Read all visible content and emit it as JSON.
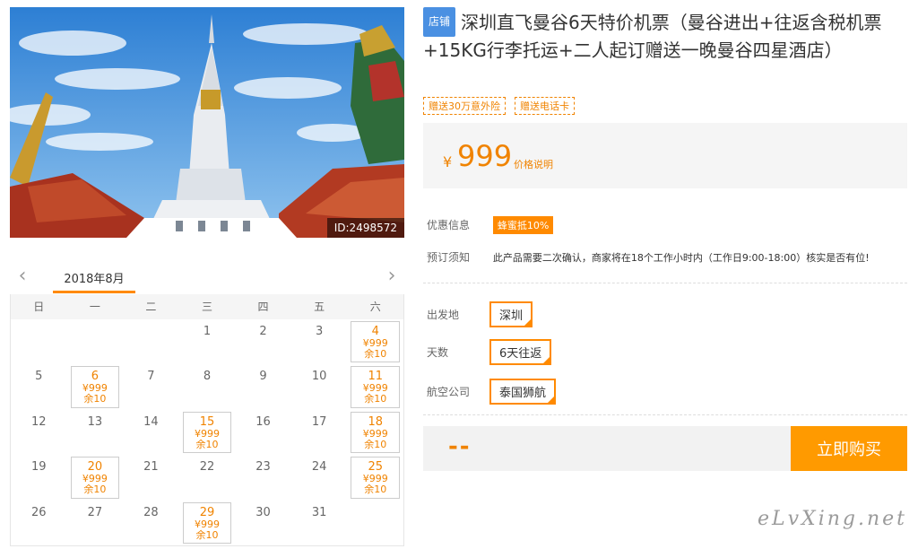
{
  "hero": {
    "id_label": "ID:2498572"
  },
  "calendar": {
    "month": "2018年8月",
    "prev_icon": "chevron-left-icon",
    "next_icon": "chevron-right-icon",
    "weekdays": [
      "日",
      "一",
      "二",
      "三",
      "四",
      "五",
      "六"
    ],
    "days": [
      {
        "d": ""
      },
      {
        "d": ""
      },
      {
        "d": ""
      },
      {
        "d": "1"
      },
      {
        "d": "2"
      },
      {
        "d": "3"
      },
      {
        "d": "4",
        "price": "¥999",
        "rest": "余10"
      },
      {
        "d": "5"
      },
      {
        "d": "6",
        "price": "¥999",
        "rest": "余10"
      },
      {
        "d": "7"
      },
      {
        "d": "8"
      },
      {
        "d": "9"
      },
      {
        "d": "10"
      },
      {
        "d": "11",
        "price": "¥999",
        "rest": "余10"
      },
      {
        "d": "12"
      },
      {
        "d": "13"
      },
      {
        "d": "14"
      },
      {
        "d": "15",
        "price": "¥999",
        "rest": "余10"
      },
      {
        "d": "16"
      },
      {
        "d": "17"
      },
      {
        "d": "18",
        "price": "¥999",
        "rest": "余10"
      },
      {
        "d": "19"
      },
      {
        "d": "20",
        "price": "¥999",
        "rest": "余10"
      },
      {
        "d": "21"
      },
      {
        "d": "22"
      },
      {
        "d": "23"
      },
      {
        "d": "24"
      },
      {
        "d": "25",
        "price": "¥999",
        "rest": "余10"
      },
      {
        "d": "26"
      },
      {
        "d": "27"
      },
      {
        "d": "28"
      },
      {
        "d": "29",
        "price": "¥999",
        "rest": "余10"
      },
      {
        "d": "30"
      },
      {
        "d": "31"
      },
      {
        "d": ""
      }
    ]
  },
  "product": {
    "shop_tag": "店铺",
    "title": "深圳直飞曼谷6天特价机票（曼谷进出+往返含税机票+15KG行李托运+二人起订赠送一晚曼谷四星酒店）",
    "gifts": [
      "赠送30万意外险",
      "赠送电话卡"
    ]
  },
  "price": {
    "currency": "¥",
    "value": "999",
    "note": "价格说明"
  },
  "info": {
    "discount_label": "优惠信息",
    "discount_badge": "蜂蜜抵10%",
    "notice_label": "预订须知",
    "notice_text": "此产品需要二次确认，商家将在18个工作小时内（工作日9:00-18:00）核实是否有位!"
  },
  "options": {
    "departure_label": "出发地",
    "departure_value": "深圳",
    "days_label": "天数",
    "days_value": "6天往返",
    "airline_label": "航空公司",
    "airline_value": "泰国狮航"
  },
  "buy": {
    "total": "--",
    "button": "立即购买"
  },
  "watermark": "eLvXing.net",
  "colors": {
    "accent": "#ff8a00",
    "price": "#f08300",
    "tag": "#4a90e2"
  }
}
